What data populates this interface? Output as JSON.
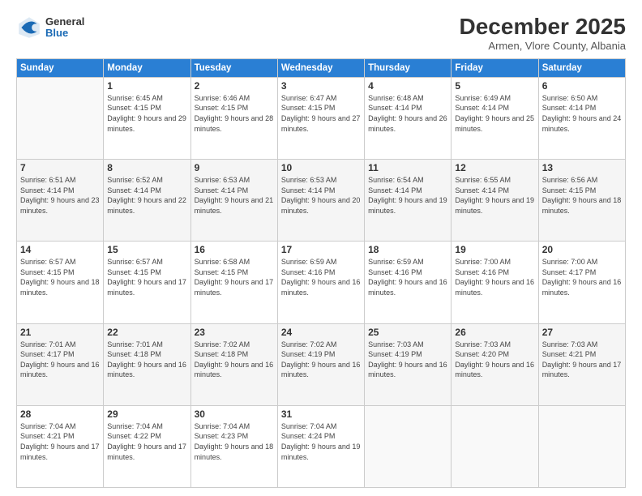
{
  "header": {
    "logo_general": "General",
    "logo_blue": "Blue",
    "month_title": "December 2025",
    "subtitle": "Armen, Vlore County, Albania"
  },
  "days_of_week": [
    "Sunday",
    "Monday",
    "Tuesday",
    "Wednesday",
    "Thursday",
    "Friday",
    "Saturday"
  ],
  "weeks": [
    [
      {
        "day": "",
        "sunrise": "",
        "sunset": "",
        "daylight": ""
      },
      {
        "day": "1",
        "sunrise": "Sunrise: 6:45 AM",
        "sunset": "Sunset: 4:15 PM",
        "daylight": "Daylight: 9 hours and 29 minutes."
      },
      {
        "day": "2",
        "sunrise": "Sunrise: 6:46 AM",
        "sunset": "Sunset: 4:15 PM",
        "daylight": "Daylight: 9 hours and 28 minutes."
      },
      {
        "day": "3",
        "sunrise": "Sunrise: 6:47 AM",
        "sunset": "Sunset: 4:15 PM",
        "daylight": "Daylight: 9 hours and 27 minutes."
      },
      {
        "day": "4",
        "sunrise": "Sunrise: 6:48 AM",
        "sunset": "Sunset: 4:14 PM",
        "daylight": "Daylight: 9 hours and 26 minutes."
      },
      {
        "day": "5",
        "sunrise": "Sunrise: 6:49 AM",
        "sunset": "Sunset: 4:14 PM",
        "daylight": "Daylight: 9 hours and 25 minutes."
      },
      {
        "day": "6",
        "sunrise": "Sunrise: 6:50 AM",
        "sunset": "Sunset: 4:14 PM",
        "daylight": "Daylight: 9 hours and 24 minutes."
      }
    ],
    [
      {
        "day": "7",
        "sunrise": "Sunrise: 6:51 AM",
        "sunset": "Sunset: 4:14 PM",
        "daylight": "Daylight: 9 hours and 23 minutes."
      },
      {
        "day": "8",
        "sunrise": "Sunrise: 6:52 AM",
        "sunset": "Sunset: 4:14 PM",
        "daylight": "Daylight: 9 hours and 22 minutes."
      },
      {
        "day": "9",
        "sunrise": "Sunrise: 6:53 AM",
        "sunset": "Sunset: 4:14 PM",
        "daylight": "Daylight: 9 hours and 21 minutes."
      },
      {
        "day": "10",
        "sunrise": "Sunrise: 6:53 AM",
        "sunset": "Sunset: 4:14 PM",
        "daylight": "Daylight: 9 hours and 20 minutes."
      },
      {
        "day": "11",
        "sunrise": "Sunrise: 6:54 AM",
        "sunset": "Sunset: 4:14 PM",
        "daylight": "Daylight: 9 hours and 19 minutes."
      },
      {
        "day": "12",
        "sunrise": "Sunrise: 6:55 AM",
        "sunset": "Sunset: 4:14 PM",
        "daylight": "Daylight: 9 hours and 19 minutes."
      },
      {
        "day": "13",
        "sunrise": "Sunrise: 6:56 AM",
        "sunset": "Sunset: 4:15 PM",
        "daylight": "Daylight: 9 hours and 18 minutes."
      }
    ],
    [
      {
        "day": "14",
        "sunrise": "Sunrise: 6:57 AM",
        "sunset": "Sunset: 4:15 PM",
        "daylight": "Daylight: 9 hours and 18 minutes."
      },
      {
        "day": "15",
        "sunrise": "Sunrise: 6:57 AM",
        "sunset": "Sunset: 4:15 PM",
        "daylight": "Daylight: 9 hours and 17 minutes."
      },
      {
        "day": "16",
        "sunrise": "Sunrise: 6:58 AM",
        "sunset": "Sunset: 4:15 PM",
        "daylight": "Daylight: 9 hours and 17 minutes."
      },
      {
        "day": "17",
        "sunrise": "Sunrise: 6:59 AM",
        "sunset": "Sunset: 4:16 PM",
        "daylight": "Daylight: 9 hours and 16 minutes."
      },
      {
        "day": "18",
        "sunrise": "Sunrise: 6:59 AM",
        "sunset": "Sunset: 4:16 PM",
        "daylight": "Daylight: 9 hours and 16 minutes."
      },
      {
        "day": "19",
        "sunrise": "Sunrise: 7:00 AM",
        "sunset": "Sunset: 4:16 PM",
        "daylight": "Daylight: 9 hours and 16 minutes."
      },
      {
        "day": "20",
        "sunrise": "Sunrise: 7:00 AM",
        "sunset": "Sunset: 4:17 PM",
        "daylight": "Daylight: 9 hours and 16 minutes."
      }
    ],
    [
      {
        "day": "21",
        "sunrise": "Sunrise: 7:01 AM",
        "sunset": "Sunset: 4:17 PM",
        "daylight": "Daylight: 9 hours and 16 minutes."
      },
      {
        "day": "22",
        "sunrise": "Sunrise: 7:01 AM",
        "sunset": "Sunset: 4:18 PM",
        "daylight": "Daylight: 9 hours and 16 minutes."
      },
      {
        "day": "23",
        "sunrise": "Sunrise: 7:02 AM",
        "sunset": "Sunset: 4:18 PM",
        "daylight": "Daylight: 9 hours and 16 minutes."
      },
      {
        "day": "24",
        "sunrise": "Sunrise: 7:02 AM",
        "sunset": "Sunset: 4:19 PM",
        "daylight": "Daylight: 9 hours and 16 minutes."
      },
      {
        "day": "25",
        "sunrise": "Sunrise: 7:03 AM",
        "sunset": "Sunset: 4:19 PM",
        "daylight": "Daylight: 9 hours and 16 minutes."
      },
      {
        "day": "26",
        "sunrise": "Sunrise: 7:03 AM",
        "sunset": "Sunset: 4:20 PM",
        "daylight": "Daylight: 9 hours and 16 minutes."
      },
      {
        "day": "27",
        "sunrise": "Sunrise: 7:03 AM",
        "sunset": "Sunset: 4:21 PM",
        "daylight": "Daylight: 9 hours and 17 minutes."
      }
    ],
    [
      {
        "day": "28",
        "sunrise": "Sunrise: 7:04 AM",
        "sunset": "Sunset: 4:21 PM",
        "daylight": "Daylight: 9 hours and 17 minutes."
      },
      {
        "day": "29",
        "sunrise": "Sunrise: 7:04 AM",
        "sunset": "Sunset: 4:22 PM",
        "daylight": "Daylight: 9 hours and 17 minutes."
      },
      {
        "day": "30",
        "sunrise": "Sunrise: 7:04 AM",
        "sunset": "Sunset: 4:23 PM",
        "daylight": "Daylight: 9 hours and 18 minutes."
      },
      {
        "day": "31",
        "sunrise": "Sunrise: 7:04 AM",
        "sunset": "Sunset: 4:24 PM",
        "daylight": "Daylight: 9 hours and 19 minutes."
      },
      {
        "day": "",
        "sunrise": "",
        "sunset": "",
        "daylight": ""
      },
      {
        "day": "",
        "sunrise": "",
        "sunset": "",
        "daylight": ""
      },
      {
        "day": "",
        "sunrise": "",
        "sunset": "",
        "daylight": ""
      }
    ]
  ]
}
